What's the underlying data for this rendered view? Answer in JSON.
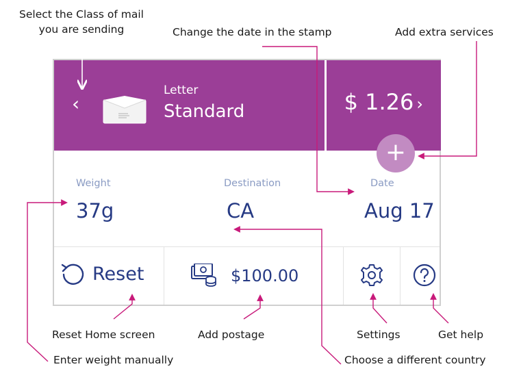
{
  "colors": {
    "brand": "#9b3e97",
    "circle": "#c28bc2",
    "navy": "#263a84",
    "annotation_line": "#c81a7a"
  },
  "annotations": {
    "select_class_line1": "Select the Class of mail",
    "select_class_line2": "you are sending",
    "change_date": "Change the date in the stamp",
    "extra_services": "Add extra services",
    "reset_home": "Reset Home screen",
    "add_postage": "Add postage",
    "settings": "Settings",
    "get_help": "Get help",
    "enter_weight": "Enter weight manually",
    "choose_country": "Choose a different country"
  },
  "header": {
    "mail_type": "Letter",
    "mail_class": "Standard",
    "price": "$ 1.26",
    "price_arrow": "›",
    "prev_arrow": "‹",
    "add_symbol": "+"
  },
  "details": {
    "weight_label": "Weight",
    "weight_value": "37g",
    "destination_label": "Destination",
    "destination_value": "CA",
    "date_label": "Date",
    "date_value": "Aug 17"
  },
  "actions": {
    "reset_label": "Reset",
    "postage_value": "$100.00"
  },
  "icons": [
    "envelope-icon",
    "chevron-left-icon",
    "chevron-right-icon",
    "plus-icon",
    "reset-icon",
    "postage-funds-icon",
    "gear-icon",
    "help-icon"
  ]
}
